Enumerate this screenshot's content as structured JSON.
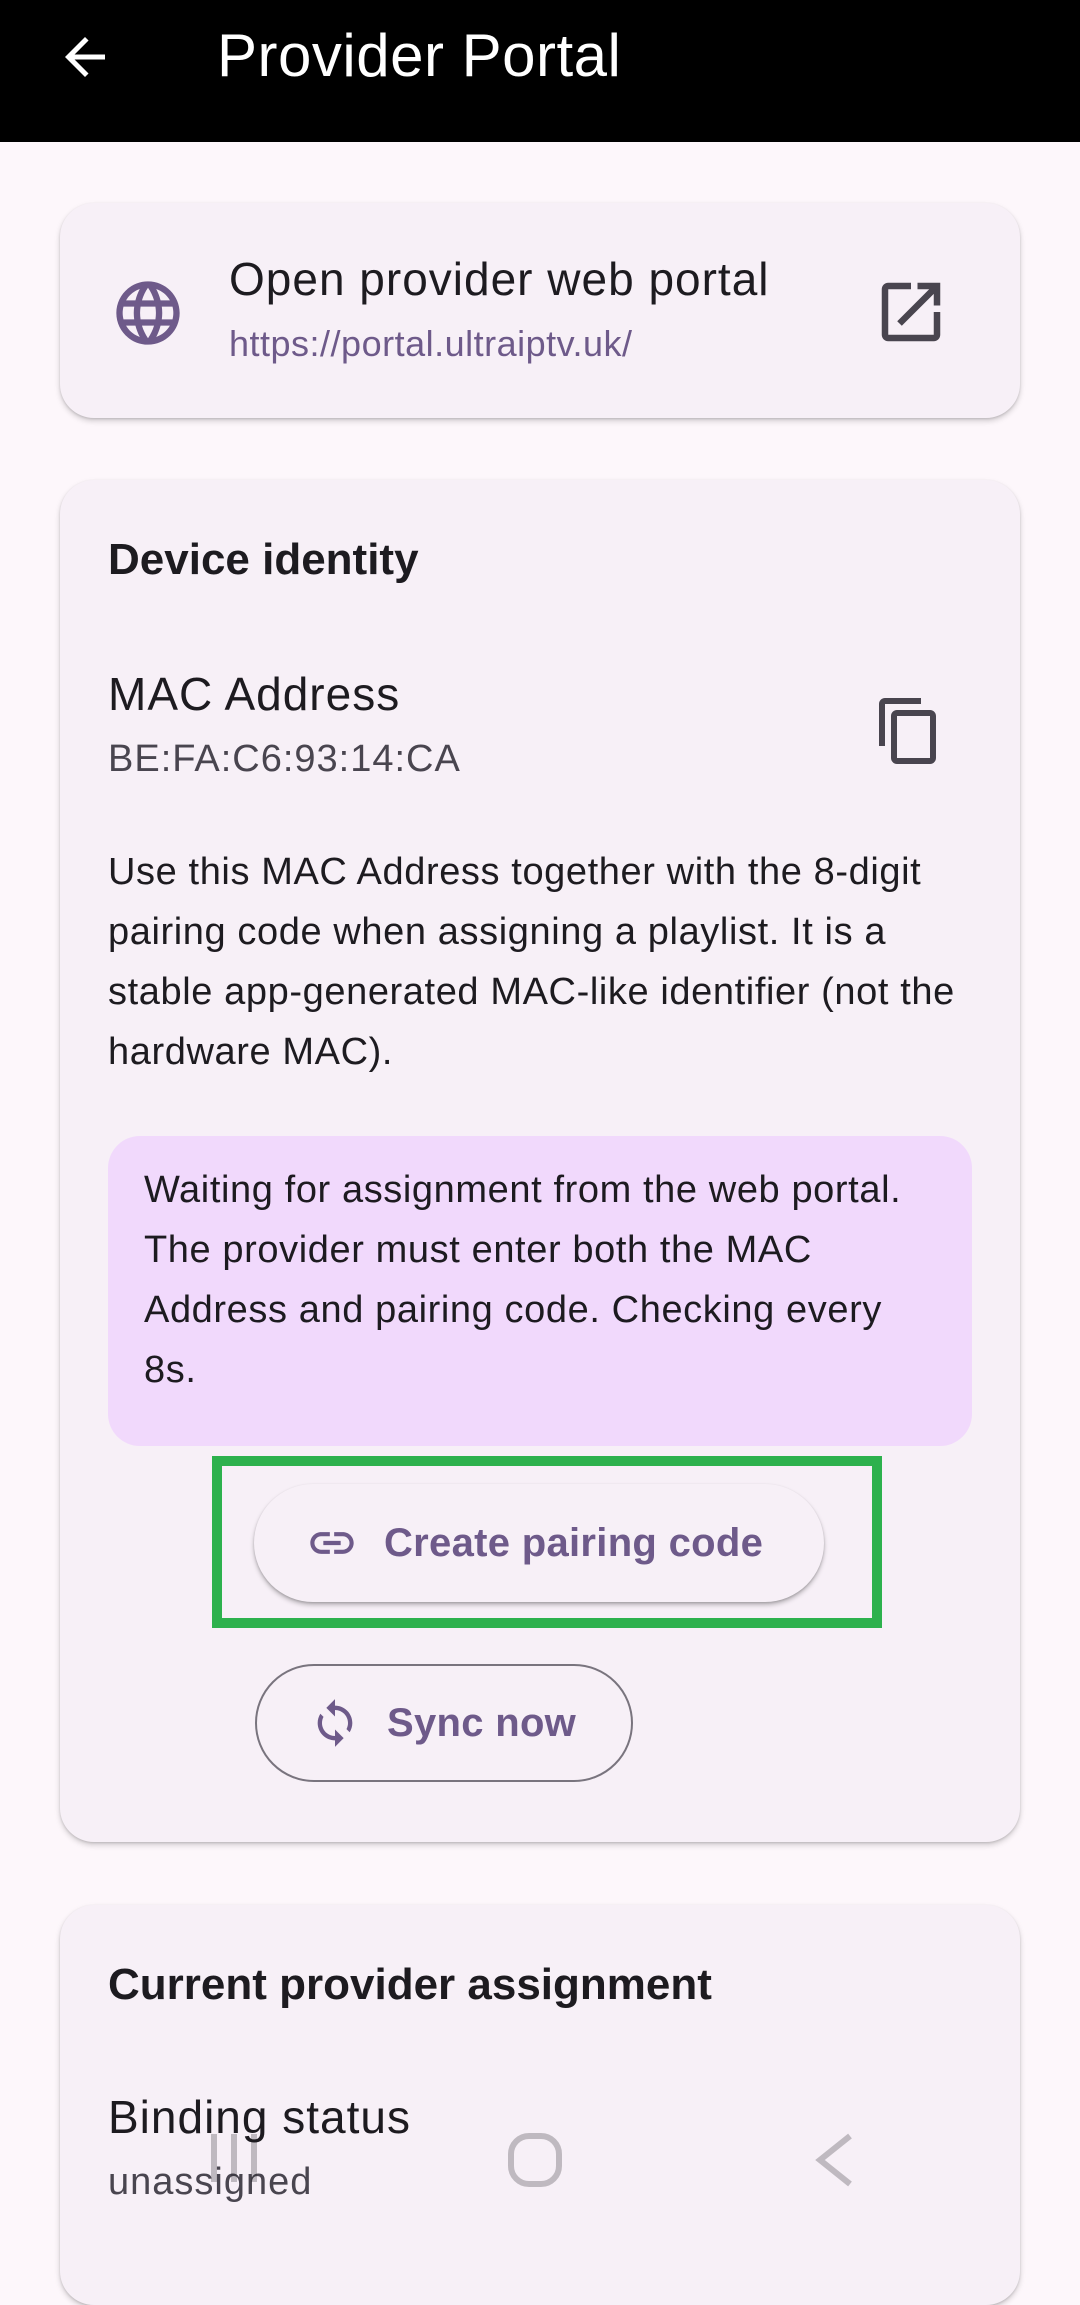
{
  "appbar": {
    "title": "Provider Portal",
    "back_icon": "arrow-left-icon"
  },
  "portal_card": {
    "title": "Open provider web portal",
    "url": "https://portal.ultraiptv.uk/",
    "leading_icon": "globe-icon",
    "trailing_icon": "open-in-new-icon"
  },
  "identity_card": {
    "title": "Device identity",
    "mac_label": "MAC Address",
    "mac_value": "BE:FA:C6:93:14:CA",
    "copy_icon": "copy-icon",
    "description": "Use this MAC Address together with the 8-digit pairing code when assigning a playlist. It is a stable app-generated MAC-like identifier (not the hardware MAC).",
    "status_message": "Waiting for assignment from the web portal. The provider must enter both the MAC Address and pairing code. Checking every 8s.",
    "create_button": {
      "label": "Create pairing code",
      "icon": "link-icon"
    },
    "sync_button": {
      "label": "Sync now",
      "icon": "sync-icon"
    }
  },
  "assignment_card": {
    "title": "Current provider assignment",
    "binding_label": "Binding status",
    "binding_value": "unassigned"
  },
  "colors": {
    "appbar_bg": "#000000",
    "page_bg": "#fdf7fb",
    "card_bg": "#f7f0f7",
    "accent": "#6e5a8a",
    "status_bg": "#f1d9fc",
    "highlight": "#2db14d"
  },
  "system_nav": {
    "icons": [
      "recent-apps-icon",
      "home-icon",
      "back-icon"
    ]
  }
}
